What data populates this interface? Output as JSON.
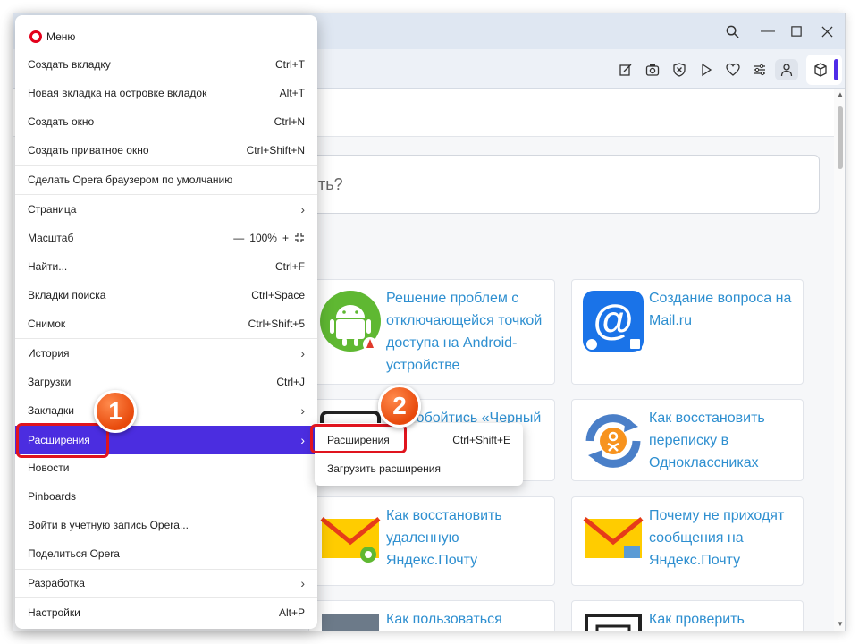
{
  "menu": {
    "title": "Меню",
    "items": [
      {
        "label": "Создать вкладку",
        "shortcut": "Ctrl+T"
      },
      {
        "label": "Новая вкладка на островке вкладок",
        "shortcut": "Alt+T"
      },
      {
        "label": "Создать окно",
        "shortcut": "Ctrl+N"
      },
      {
        "label": "Создать приватное окно",
        "shortcut": "Ctrl+Shift+N"
      },
      {
        "label": "Сделать Opera браузером по умолчанию"
      },
      {
        "label": "Страница"
      },
      {
        "label": "Масштаб",
        "zoom": "100%"
      },
      {
        "label": "Найти...",
        "shortcut": "Ctrl+F"
      },
      {
        "label": "Вкладки поиска",
        "shortcut": "Ctrl+Space"
      },
      {
        "label": "Снимок",
        "shortcut": "Ctrl+Shift+5"
      },
      {
        "label": "История"
      },
      {
        "label": "Загрузки",
        "shortcut": "Ctrl+J"
      },
      {
        "label": "Закладки"
      },
      {
        "label": "Расширения"
      },
      {
        "label": "Новости"
      },
      {
        "label": "Pinboards"
      },
      {
        "label": "Войти в учетную запись Opera..."
      },
      {
        "label": "Поделиться Opera"
      },
      {
        "label": "Разработка"
      },
      {
        "label": "Настройки",
        "shortcut": "Alt+P"
      }
    ]
  },
  "submenu": {
    "items": [
      {
        "label": "Расширения",
        "shortcut": "Ctrl+Shift+E"
      },
      {
        "label": "Загрузить расширения"
      }
    ]
  },
  "badges": {
    "one": "1",
    "two": "2"
  },
  "page": {
    "search_fragment": "ить?",
    "cards": [
      {
        "title": "Решение проблем с отключающейся точкой доступа на Android-устройстве"
      },
      {
        "title": "Создание вопроса на Mail.ru"
      },
      {
        "title": "...ак обойтись «Черный ...писок ...ласcниках"
      },
      {
        "title": "Как восстановить переписку в Одноклассниках"
      },
      {
        "title": "Как восстановить удаленную Яндекс.Почту"
      },
      {
        "title": "Почему не приходят сообщения на Яндекс.Почту"
      },
      {
        "title": "Как пользоваться"
      },
      {
        "title": "Как проверить"
      }
    ]
  },
  "colors": {
    "accent": "#4b2de0",
    "link": "#2e8fd0",
    "highlight": "#e0141e",
    "badge": "#f06420"
  }
}
